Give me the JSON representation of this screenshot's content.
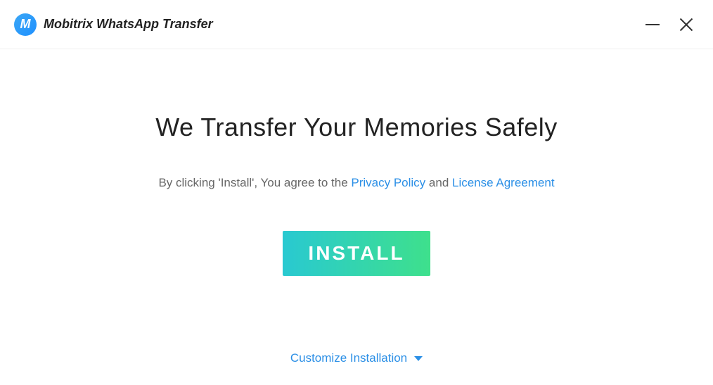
{
  "header": {
    "app_title": "Mobitrix WhatsApp Transfer",
    "logo_letter": "M"
  },
  "main": {
    "headline": "We Transfer Your Memories Safely",
    "agreement_prefix": "By clicking 'Install', You agree to the ",
    "privacy_link": "Privacy Policy",
    "agreement_mid": " and  ",
    "license_link": "License Agreement",
    "install_label": "INSTALL",
    "customize_label": "Customize Installation"
  }
}
